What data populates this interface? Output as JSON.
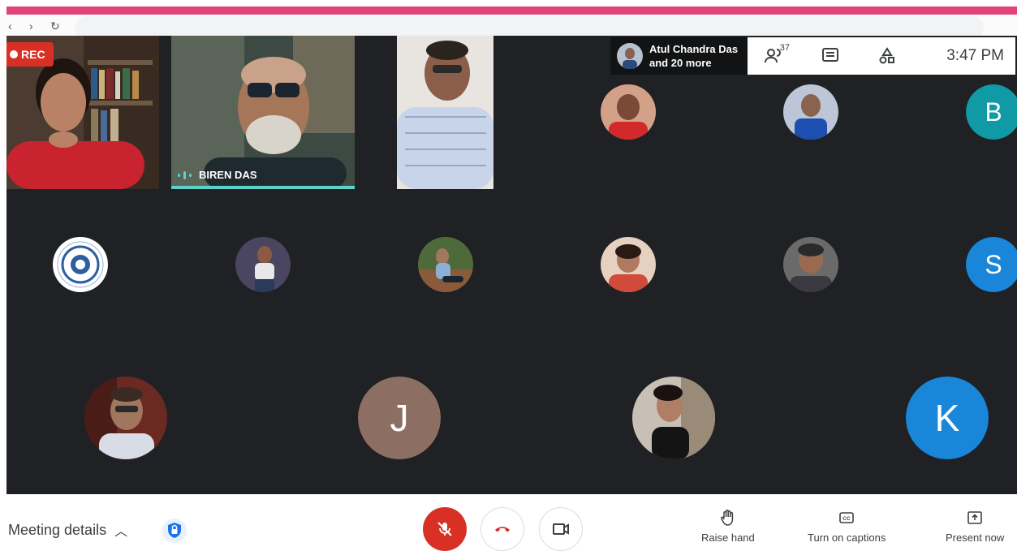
{
  "recording_label": "REC",
  "speaker": {
    "name": "BIREN DAS"
  },
  "info_panel": {
    "line1": "Atul Chandra Das",
    "line2": "and 20 more"
  },
  "tray": {
    "participant_count": "37",
    "time": "3:47 PM"
  },
  "avatars": {
    "b": "B",
    "s": "S",
    "j": "J",
    "k": "K"
  },
  "bottom": {
    "meeting_details": "Meeting details",
    "raise_hand": "Raise hand",
    "captions": "Turn on captions",
    "present": "Present now"
  },
  "colors": {
    "accent_pink": "#e0457a",
    "rec_red": "#d93025",
    "stage_bg": "#202124",
    "avatar_b": "#0f9aa5",
    "avatar_s": "#1a86d9",
    "avatar_j": "#8d6e63",
    "avatar_k": "#1a86d9",
    "speaking_bar": "#5bd1c8"
  }
}
